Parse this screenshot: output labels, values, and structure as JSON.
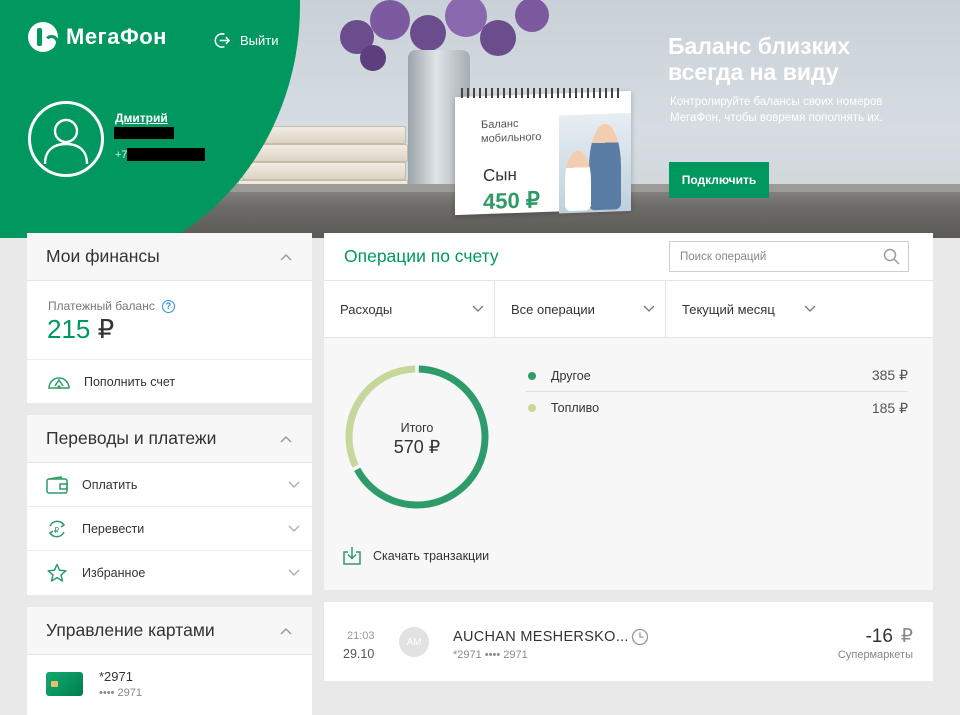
{
  "header": {
    "brand": "МегаФон",
    "logout_label": "Выйти",
    "user_name": "Дмитрий",
    "phone_prefix": "+7"
  },
  "promo": {
    "title": "Баланс близких всегда на виду",
    "text": "Контролируйте балансы своих номеров МегаФон, чтобы вовремя пополнять их.",
    "button_label": "Подключить",
    "calendar_caption": "Баланс мобильного",
    "calendar_who": "Сын",
    "calendar_amount": "450 ₽"
  },
  "finances": {
    "title": "Мои финансы",
    "balance_label": "Платежный баланс",
    "balance_amount": "215",
    "currency": "₽",
    "topup_label": "Пополнить счет"
  },
  "payments": {
    "title": "Переводы и платежи",
    "items": [
      {
        "label": "Оплатить",
        "icon": "wallet-icon"
      },
      {
        "label": "Перевести",
        "icon": "transfer-icon"
      },
      {
        "label": "Избранное",
        "icon": "star-icon"
      }
    ]
  },
  "cards": {
    "title": "Управление картами",
    "card_number": "*2971",
    "card_mask": "•••• 2971"
  },
  "operations": {
    "title": "Операции по счету",
    "search_placeholder": "Поиск операций",
    "filters": [
      "Расходы",
      "Все операции",
      "Текущий месяц"
    ],
    "total_label": "Итого",
    "total_value": "570 ₽",
    "download_label": "Скачать транзакции",
    "colors": {
      "other": "#2e9c6a",
      "fuel": "#c7d69a"
    }
  },
  "chart_data": {
    "type": "pie",
    "categories": [
      "Другое",
      "Топливо"
    ],
    "values": [
      385,
      185
    ],
    "value_labels": [
      "385 ₽",
      "185 ₽"
    ],
    "total": 570
  },
  "transaction": {
    "time": "21:03",
    "date": "29.10",
    "avatar_initials": "AM",
    "merchant": "AUCHAN MESHERSKO...",
    "account": "*2971 •••• 2971",
    "amount": "-16",
    "currency": "₽",
    "category": "Супермаркеты"
  }
}
